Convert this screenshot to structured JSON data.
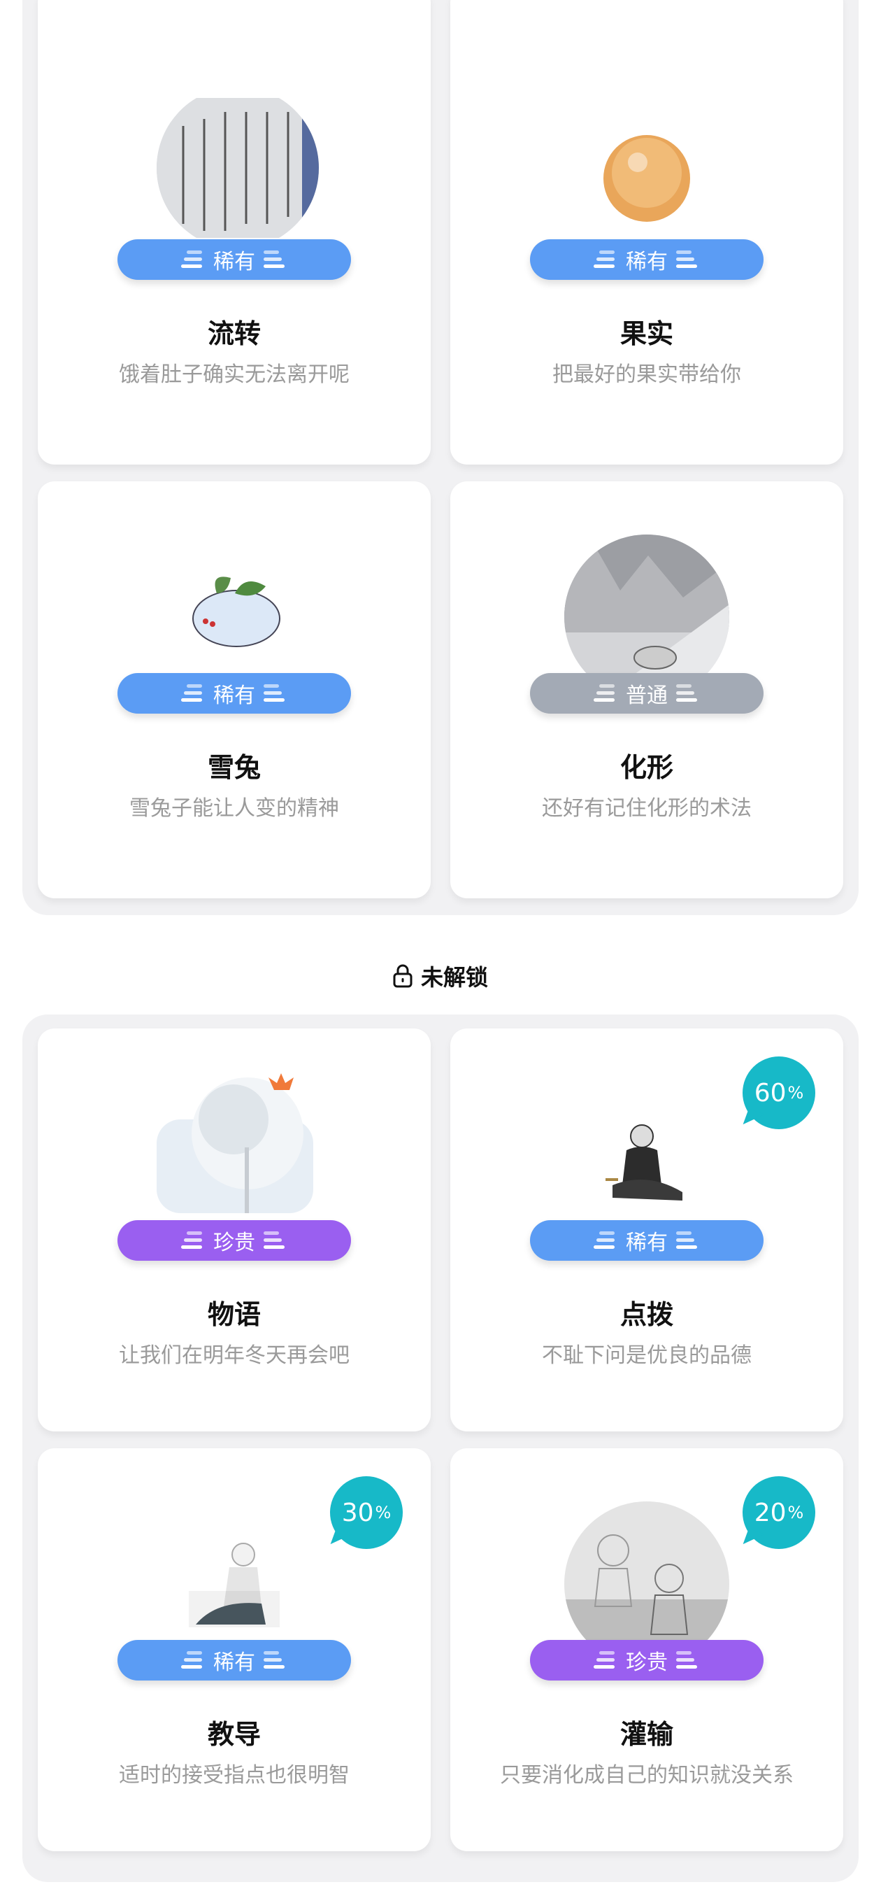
{
  "close_icon": "close-icon",
  "colors": {
    "rare": "#5b9cf4",
    "common": "#a3aab5",
    "precious": "#9a5ff0",
    "progress": "#17b9c8"
  },
  "unlocked_cards": [
    {
      "title": "流转",
      "desc": "饿着肚子确实无法离开呢",
      "rarity": "稀有"
    },
    {
      "title": "果实",
      "desc": "把最好的果实带给你",
      "rarity": "稀有"
    },
    {
      "title": "雪兔",
      "desc": "雪兔子能让人变的精神",
      "rarity": "稀有"
    },
    {
      "title": "化形",
      "desc": "还好有记住化形的术法",
      "rarity": "普通"
    }
  ],
  "locked_section": {
    "icon": "lock-icon",
    "label": "未解锁"
  },
  "locked_cards": [
    {
      "title": "物语",
      "desc": "让我们在明年冬天再会吧",
      "rarity": "珍贵"
    },
    {
      "title": "点拨",
      "desc": "不耻下问是优良的品德",
      "rarity": "稀有",
      "progress": "60",
      "unit": "%"
    },
    {
      "title": "教导",
      "desc": "适时的接受指点也很明智",
      "rarity": "稀有",
      "progress": "30",
      "unit": "%"
    },
    {
      "title": "灌输",
      "desc": "只要消化成自己的知识就没关系",
      "rarity": "珍贵",
      "progress": "20",
      "unit": "%"
    }
  ]
}
